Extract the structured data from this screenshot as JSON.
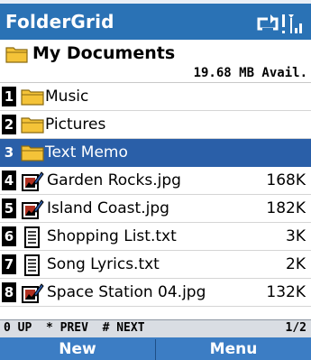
{
  "app": {
    "title": "FolderGrid"
  },
  "status_icons": [
    "sync-icon",
    "signal-strength-icon"
  ],
  "folder": {
    "icon": "folder-icon",
    "title": "My Documents",
    "free_space": "19.68 MB Avail."
  },
  "items": [
    {
      "key": "1",
      "icon": "folder-icon",
      "name": "Music",
      "size": "",
      "selected": false
    },
    {
      "key": "2",
      "icon": "folder-icon",
      "name": "Pictures",
      "size": "",
      "selected": false
    },
    {
      "key": "3",
      "icon": "folder-icon",
      "name": "Text Memo",
      "size": "",
      "selected": true
    },
    {
      "key": "4",
      "icon": "image-file-icon",
      "name": "Garden Rocks.jpg",
      "size": "168K",
      "selected": false
    },
    {
      "key": "5",
      "icon": "image-file-icon",
      "name": "Island Coast.jpg",
      "size": "182K",
      "selected": false
    },
    {
      "key": "6",
      "icon": "text-file-icon",
      "name": "Shopping List.txt",
      "size": "3K",
      "selected": false
    },
    {
      "key": "7",
      "icon": "text-file-icon",
      "name": "Song Lyrics.txt",
      "size": "2K",
      "selected": false
    },
    {
      "key": "8",
      "icon": "image-file-icon",
      "name": "Space Station 04.jpg",
      "size": "132K",
      "selected": false
    }
  ],
  "navbar": {
    "hint": "0 UP  * PREV  # NEXT",
    "page": "1/2"
  },
  "softkeys": {
    "left": "New",
    "right": "Menu"
  },
  "colors": {
    "title_bar": "#2a72b5",
    "selection": "#2a5fa8",
    "softkey_bar": "#3c7dc4",
    "folder_yellow": "#f4c338"
  }
}
